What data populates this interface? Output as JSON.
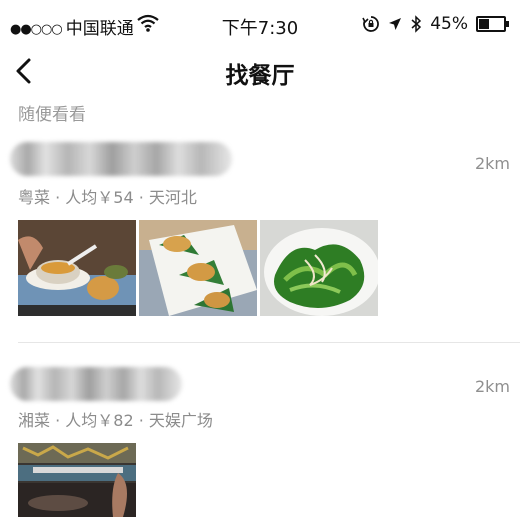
{
  "status_bar": {
    "signal": "●●○○○",
    "carrier": "中国联通",
    "time": "下午7:30",
    "battery_pct": "45%",
    "battery_level": 0.45,
    "icons": [
      "wifi-icon",
      "orientation-lock-icon",
      "location-arrow-icon",
      "bluetooth-icon",
      "battery-icon"
    ]
  },
  "nav": {
    "title": "找餐厅",
    "back_icon": "chevron-left-icon"
  },
  "section": {
    "label": "随便看看"
  },
  "restaurants": [
    {
      "name": "",
      "distance": "2km",
      "meta": "粤菜 · 人均￥54 · 天河北",
      "photos": [
        "food-photo-soup-pastry",
        "food-photo-dumplings",
        "food-photo-greens"
      ]
    },
    {
      "name": "",
      "distance": "2km",
      "meta": "湘菜 · 人均￥82 · 天娱广场",
      "photos": [
        "food-photo-dish"
      ]
    }
  ]
}
